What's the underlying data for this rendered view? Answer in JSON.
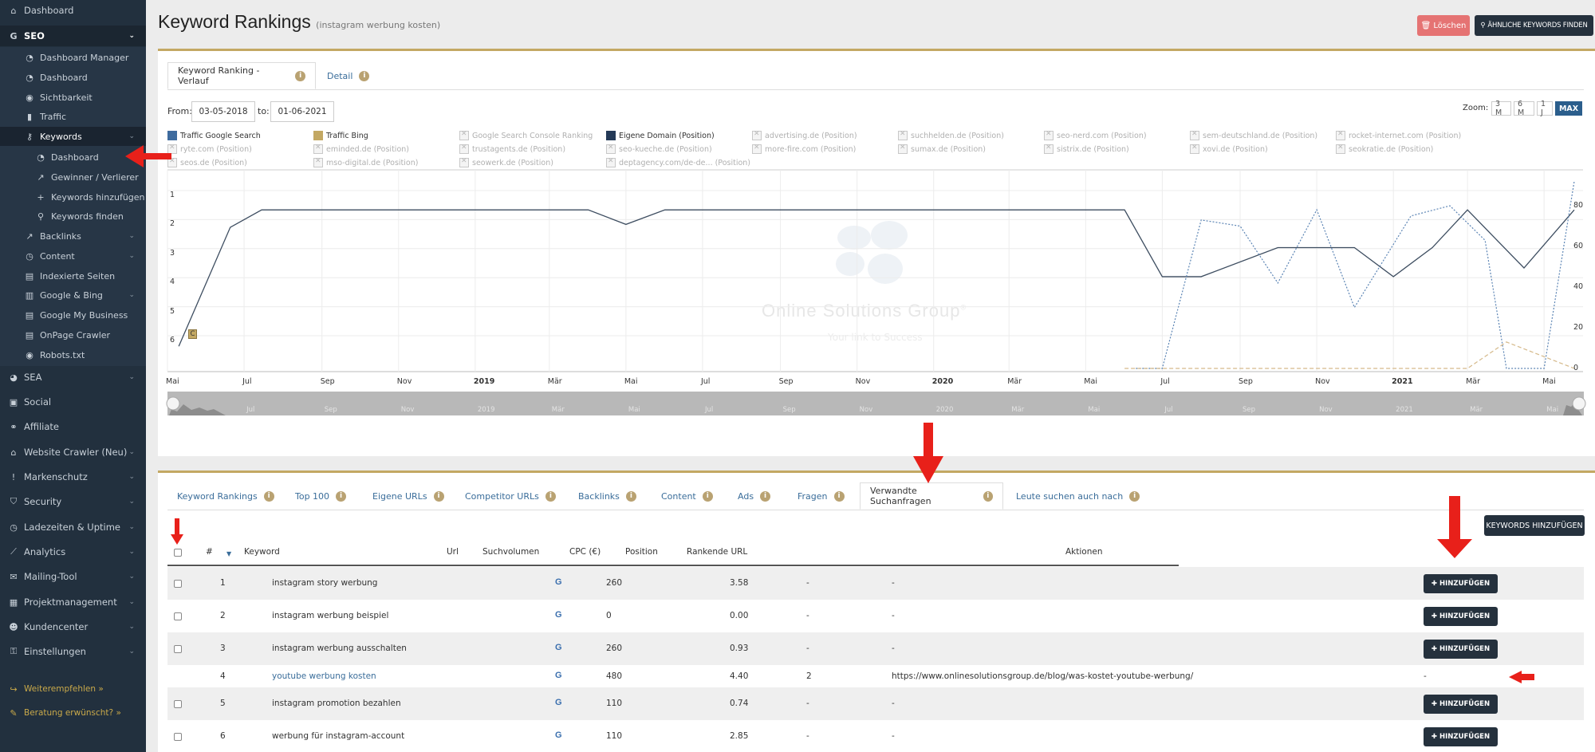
{
  "sidebar": {
    "dashboard": "Dashboard",
    "seo": "SEO",
    "seo_items": [
      "Dashboard Manager",
      "Dashboard",
      "Sichtbarkeit",
      "Traffic"
    ],
    "keywords": "Keywords",
    "keyword_items": [
      "Dashboard",
      "Gewinner / Verlierer",
      "Keywords hinzufügen",
      "Keywords finden"
    ],
    "seo_more": [
      "Backlinks",
      "Content",
      "Indexierte Seiten",
      "Google & Bing",
      "Google My Business",
      "OnPage Crawler",
      "Robots.txt"
    ],
    "main_items": [
      "SEA",
      "Social",
      "Affiliate",
      "Website Crawler (Neu)",
      "Markenschutz",
      "Security",
      "Ladezeiten & Uptime",
      "Analytics",
      "Mailing-Tool",
      "Projektmanagement",
      "Kundencenter",
      "Einstellungen"
    ],
    "promo": [
      "Weiterempfehlen »",
      "Beratung erwünscht? »"
    ]
  },
  "header": {
    "title": "Keyword Rankings",
    "subtitle": "(instagram werbung kosten)",
    "delete_label": "Löschen",
    "similar_label": "ÄHNLICHE KEYWORDS FINDEN"
  },
  "chart_panel": {
    "tabs": [
      "Keyword Ranking - Verlauf",
      "Detail"
    ],
    "from_label": "From:",
    "from_value": "03-05-2018",
    "to_label": "to:",
    "to_value": "01-06-2021",
    "zoom_label": "Zoom:",
    "zoom_options": [
      "3 M",
      "6 M",
      "1 J",
      "MAX"
    ],
    "watermark": "Online Solutions Group",
    "watermark_tm": "®",
    "watermark_sub": "Your link to Success"
  },
  "chart_data": {
    "type": "line",
    "legend": [
      {
        "name": "Traffic Google Search",
        "color": "#3e6b9e",
        "enabled": true
      },
      {
        "name": "Traffic Bing",
        "color": "#c3a863",
        "enabled": true
      },
      {
        "name": "Google Search Console Ranking",
        "enabled": false
      },
      {
        "name": "Eigene Domain (Position)",
        "color": "#243a57",
        "enabled": true
      },
      {
        "name": "advertising.de (Position)",
        "enabled": false
      },
      {
        "name": "suchhelden.de (Position)",
        "enabled": false
      },
      {
        "name": "seo-nerd.com (Position)",
        "enabled": false
      },
      {
        "name": "sem-deutschland.de (Position)",
        "enabled": false
      },
      {
        "name": "rocket-internet.com (Position)",
        "enabled": false
      },
      {
        "name": "ryte.com (Position)",
        "enabled": false
      },
      {
        "name": "eminded.de (Position)",
        "enabled": false
      },
      {
        "name": "trustagents.de (Position)",
        "enabled": false
      },
      {
        "name": "seo-kueche.de (Position)",
        "enabled": false
      },
      {
        "name": "more-fire.com (Position)",
        "enabled": false
      },
      {
        "name": "sumax.de (Position)",
        "enabled": false
      },
      {
        "name": "sistrix.de (Position)",
        "enabled": false
      },
      {
        "name": "xovi.de (Position)",
        "enabled": false
      },
      {
        "name": "seokratie.de (Position)",
        "enabled": false
      },
      {
        "name": "seos.de (Position)",
        "enabled": false
      },
      {
        "name": "mso-digital.de (Position)",
        "enabled": false
      },
      {
        "name": "seowerk.de (Position)",
        "enabled": false
      },
      {
        "name": "deptagency.com/de-de... (Position)",
        "enabled": false
      }
    ],
    "x_ticks": [
      "Mai",
      "Jul",
      "Sep",
      "Nov",
      "2019",
      "Mär",
      "Mai",
      "Jul",
      "Sep",
      "Nov",
      "2020",
      "Mär",
      "Mai",
      "Jul",
      "Sep",
      "Nov",
      "2021",
      "Mär",
      "Mai"
    ],
    "x_ticks_bold": [
      "2019",
      "2020",
      "2021"
    ],
    "navigator_ticks": [
      "Jul",
      "Sep",
      "Nov",
      "2019",
      "Mär",
      "Mai",
      "Jul",
      "Sep",
      "Nov",
      "2020",
      "Mär",
      "Mai",
      "Jul",
      "Sep",
      "Nov",
      "2021",
      "Mär",
      "Mai"
    ],
    "y_left_ticks": [
      "1",
      "2",
      "3",
      "4",
      "5",
      "6"
    ],
    "y_right_ticks": [
      "80",
      "60",
      "40",
      "20",
      "0"
    ],
    "flag_label": "C",
    "series": [
      {
        "name": "Eigene Domain (Position)",
        "axis": "left",
        "style": "solid",
        "points": [
          [
            "2018-05-10",
            6.2
          ],
          [
            "2018-06-20",
            2.1
          ],
          [
            "2018-07-15",
            1.5
          ],
          [
            "2019-02-10",
            1.5
          ],
          [
            "2019-04-01",
            1.5
          ],
          [
            "2019-05-01",
            2.0
          ],
          [
            "2019-06-01",
            1.5
          ],
          [
            "2020-06-01",
            1.5
          ],
          [
            "2020-07-01",
            3.8
          ],
          [
            "2020-08-01",
            3.8
          ],
          [
            "2020-10-01",
            2.8
          ],
          [
            "2020-12-01",
            2.8
          ],
          [
            "2021-01-01",
            3.8
          ],
          [
            "2021-02-01",
            2.8
          ],
          [
            "2021-03-01",
            1.5
          ],
          [
            "2021-04-15",
            3.5
          ],
          [
            "2021-05-25",
            1.5
          ]
        ]
      },
      {
        "name": "Traffic Google Search",
        "axis": "right",
        "style": "dotted",
        "points": [
          [
            "2020-06-10",
            0
          ],
          [
            "2020-07-01",
            0
          ],
          [
            "2020-08-01",
            73
          ],
          [
            "2020-09-01",
            70
          ],
          [
            "2020-10-01",
            42
          ],
          [
            "2020-11-01",
            78
          ],
          [
            "2020-12-01",
            30
          ],
          [
            "2021-01-15",
            75
          ],
          [
            "2021-02-15",
            80
          ],
          [
            "2021-03-15",
            63
          ],
          [
            "2021-04-01",
            0
          ],
          [
            "2021-05-01",
            0
          ],
          [
            "2021-05-25",
            92
          ]
        ]
      },
      {
        "name": "Traffic Bing",
        "axis": "right",
        "style": "dashed",
        "points": [
          [
            "2020-06-01",
            0
          ],
          [
            "2020-07-01",
            0
          ],
          [
            "2021-03-01",
            0
          ],
          [
            "2021-04-01",
            13
          ],
          [
            "2021-05-25",
            0
          ]
        ]
      }
    ]
  },
  "table_panel": {
    "tabs": [
      "Keyword Rankings",
      "Top 100",
      "Eigene URLs",
      "Competitor URLs",
      "Backlinks",
      "Content",
      "Ads",
      "Fragen",
      "Verwandte Suchanfragen",
      "Leute suchen auch nach"
    ],
    "active_tab": "Verwandte Suchanfragen",
    "add_keywords_label": "KEYWORDS HINZUFÜGEN",
    "headers": [
      "#",
      "Keyword",
      "Url",
      "Suchvolumen",
      "CPC (€)",
      "Position",
      "Rankende URL",
      "Aktionen"
    ],
    "add_label": "HINZUFÜGEN",
    "rows": [
      {
        "num": "1",
        "keyword": "instagram story werbung",
        "engine": "G",
        "volume": "260",
        "cpc": "3.58",
        "position": "-",
        "url": "-",
        "action": "add"
      },
      {
        "num": "2",
        "keyword": "instagram werbung beispiel",
        "engine": "G",
        "volume": "0",
        "cpc": "0.00",
        "position": "-",
        "url": "-",
        "action": "add"
      },
      {
        "num": "3",
        "keyword": "instagram werbung ausschalten",
        "engine": "G",
        "volume": "260",
        "cpc": "0.93",
        "position": "-",
        "url": "-",
        "action": "add"
      },
      {
        "num": "4",
        "keyword": "youtube werbung kosten",
        "engine": "G",
        "volume": "480",
        "cpc": "4.40",
        "position": "2",
        "url": "https://www.onlinesolutionsgroup.de/blog/was-kostet-youtube-werbung/",
        "action": "-"
      },
      {
        "num": "5",
        "keyword": "instagram promotion bezahlen",
        "engine": "G",
        "volume": "110",
        "cpc": "0.74",
        "position": "-",
        "url": "-",
        "action": "add"
      },
      {
        "num": "6",
        "keyword": "werbung für instagram-account",
        "engine": "G",
        "volume": "110",
        "cpc": "2.85",
        "position": "-",
        "url": "-",
        "action": "add"
      }
    ]
  },
  "colors": {
    "sidebar_bg": "#22303e",
    "accent_gold": "#c3a863",
    "button_dark": "#25313d",
    "button_delete": "#e57373",
    "annotation_red": "#e8201a"
  }
}
